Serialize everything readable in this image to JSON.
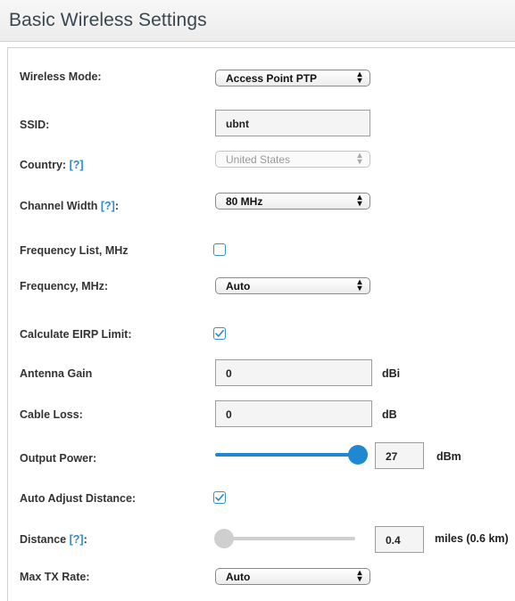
{
  "header": {
    "title": "Basic Wireless Settings"
  },
  "colors": {
    "accent": "#2a8bd4",
    "slider_fill": "#1f88d2",
    "slider_disabled": "#cfcfcf"
  },
  "fields": {
    "wireless_mode": {
      "label": "Wireless Mode:",
      "value": "Access Point PTP"
    },
    "ssid": {
      "label": "SSID:",
      "value": "ubnt"
    },
    "country": {
      "label": "Country:",
      "help": "[?]",
      "value": "United States"
    },
    "channel_width": {
      "label": "Channel Width",
      "help": "[?]",
      "suffix": ":",
      "value": "80 MHz"
    },
    "frequency_list": {
      "label": "Frequency List, MHz",
      "checked": false
    },
    "frequency": {
      "label": "Frequency, MHz:",
      "value": "Auto"
    },
    "calculate_eirp": {
      "label": "Calculate EIRP Limit:",
      "checked": true
    },
    "antenna_gain": {
      "label": "Antenna Gain",
      "value": "0",
      "unit": "dBi"
    },
    "cable_loss": {
      "label": "Cable Loss:",
      "value": "0",
      "unit": "dB"
    },
    "output_power": {
      "label": "Output Power:",
      "value": "27",
      "unit": "dBm",
      "slider_fraction": 1.0
    },
    "auto_adjust_distance": {
      "label": "Auto Adjust Distance:",
      "checked": true
    },
    "distance": {
      "label": "Distance",
      "help": "[?]",
      "suffix": ":",
      "value": "0.4",
      "unit": "miles (0.6 km)",
      "slider_fraction": 0.0,
      "slider_enabled": false
    },
    "max_tx_rate": {
      "label": "Max TX Rate:",
      "value": "Auto"
    }
  }
}
